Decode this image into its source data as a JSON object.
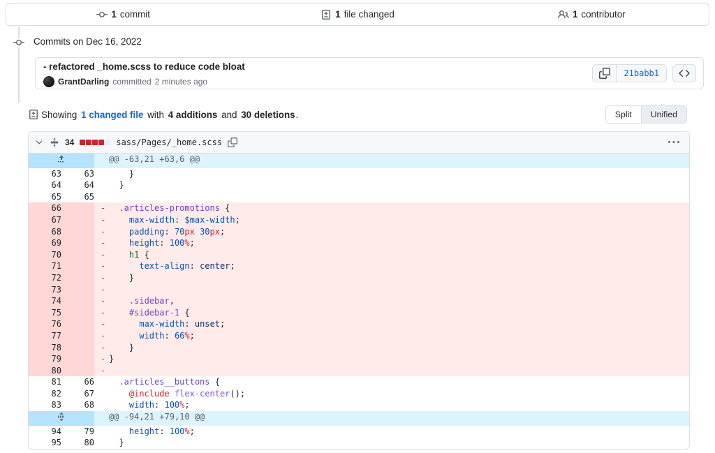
{
  "summary_tabs": [
    {
      "icon": "commit-icon",
      "count": "1",
      "label": "commit",
      "name": "tab-commits"
    },
    {
      "icon": "file-diff-icon",
      "count": "1",
      "label": "file changed",
      "name": "tab-files-changed"
    },
    {
      "icon": "people-icon",
      "count": "1",
      "label": "contributor",
      "name": "tab-contributors"
    }
  ],
  "timeline": {
    "heading": "Commits on Dec 16, 2022"
  },
  "commit": {
    "title": "- refactored _home.scss to reduce code bloat",
    "author": "GrantDarling",
    "meta_verb": "committed",
    "time": "2 minutes ago",
    "sha": "21babb1",
    "copy_icon": "copy-icon",
    "code_icon": "code-icon"
  },
  "showing": {
    "icon": "file-diff-icon",
    "prefix": "Showing",
    "file_link": "1 changed file",
    "with": "with",
    "additions": "4 additions",
    "and": "and",
    "deletions": "30 deletions",
    "period": ".",
    "view_modes": [
      {
        "label": "Split",
        "selected": false
      },
      {
        "label": "Unified",
        "selected": true
      }
    ]
  },
  "file": {
    "chevron_icon": "chevron-down-icon",
    "move_icon": "move-diff-icon",
    "change_count": "34",
    "stat_blocks": [
      "del",
      "del",
      "del",
      "del",
      "none"
    ],
    "path": "sass/Pages/_home.scss",
    "copy_path_icon": "copy-icon",
    "menu_icon": "kebab-horizontal-icon"
  },
  "diff_rows": [
    {
      "type": "hunk",
      "expand_icon": "expand-up-icon",
      "text": "@@ -63,21 +63,6 @@"
    },
    {
      "type": "ctx",
      "old": "63",
      "new": "63",
      "mark": " ",
      "parts": [
        {
          "t": "    }",
          "c": "s-pun"
        }
      ]
    },
    {
      "type": "ctx",
      "old": "64",
      "new": "64",
      "mark": " ",
      "parts": [
        {
          "t": "  }",
          "c": "s-pun"
        }
      ]
    },
    {
      "type": "ctx",
      "old": "65",
      "new": "65",
      "mark": " ",
      "parts": [
        {
          "t": "",
          "c": "s-pun"
        }
      ]
    },
    {
      "type": "del",
      "old": "66",
      "new": "",
      "mark": "-",
      "parts": [
        {
          "t": "  ",
          "c": "s-pun"
        },
        {
          "t": ".articles-promotions",
          "c": "s-sel"
        },
        {
          "t": " {",
          "c": "s-pun"
        }
      ]
    },
    {
      "type": "del",
      "old": "67",
      "new": "",
      "mark": "-",
      "parts": [
        {
          "t": "    ",
          "c": "s-pun"
        },
        {
          "t": "max-width",
          "c": "s-prop"
        },
        {
          "t": ": ",
          "c": "s-pun"
        },
        {
          "t": "$max-width",
          "c": "s-var"
        },
        {
          "t": ";",
          "c": "s-pun"
        }
      ]
    },
    {
      "type": "del",
      "old": "68",
      "new": "",
      "mark": "-",
      "parts": [
        {
          "t": "    ",
          "c": "s-pun"
        },
        {
          "t": "padding",
          "c": "s-prop"
        },
        {
          "t": ": ",
          "c": "s-pun"
        },
        {
          "t": "70",
          "c": "s-num"
        },
        {
          "t": "px",
          "c": "s-unit"
        },
        {
          "t": " ",
          "c": "s-pun"
        },
        {
          "t": "30",
          "c": "s-num"
        },
        {
          "t": "px",
          "c": "s-unit"
        },
        {
          "t": ";",
          "c": "s-pun"
        }
      ]
    },
    {
      "type": "del",
      "old": "69",
      "new": "",
      "mark": "-",
      "parts": [
        {
          "t": "    ",
          "c": "s-pun"
        },
        {
          "t": "height",
          "c": "s-prop"
        },
        {
          "t": ": ",
          "c": "s-pun"
        },
        {
          "t": "100",
          "c": "s-num"
        },
        {
          "t": "%",
          "c": "s-unit"
        },
        {
          "t": ";",
          "c": "s-pun"
        }
      ]
    },
    {
      "type": "del",
      "old": "70",
      "new": "",
      "mark": "-",
      "parts": [
        {
          "t": "    ",
          "c": "s-pun"
        },
        {
          "t": "h1",
          "c": "s-tag"
        },
        {
          "t": " {",
          "c": "s-pun"
        }
      ]
    },
    {
      "type": "del",
      "old": "71",
      "new": "",
      "mark": "-",
      "parts": [
        {
          "t": "      ",
          "c": "s-pun"
        },
        {
          "t": "text-align",
          "c": "s-prop"
        },
        {
          "t": ": ",
          "c": "s-pun"
        },
        {
          "t": "center",
          "c": "s-val"
        },
        {
          "t": ";",
          "c": "s-pun"
        }
      ]
    },
    {
      "type": "del",
      "old": "72",
      "new": "",
      "mark": "-",
      "parts": [
        {
          "t": "    }",
          "c": "s-pun"
        }
      ]
    },
    {
      "type": "del",
      "old": "73",
      "new": "",
      "mark": "-",
      "parts": [
        {
          "t": "",
          "c": "s-pun"
        }
      ]
    },
    {
      "type": "del",
      "old": "74",
      "new": "",
      "mark": "-",
      "parts": [
        {
          "t": "    ",
          "c": "s-pun"
        },
        {
          "t": ".sidebar",
          "c": "s-sel"
        },
        {
          "t": ",",
          "c": "s-pun"
        }
      ]
    },
    {
      "type": "del",
      "old": "75",
      "new": "",
      "mark": "-",
      "parts": [
        {
          "t": "    ",
          "c": "s-pun"
        },
        {
          "t": "#sidebar-1",
          "c": "s-sel"
        },
        {
          "t": " {",
          "c": "s-pun"
        }
      ]
    },
    {
      "type": "del",
      "old": "76",
      "new": "",
      "mark": "-",
      "parts": [
        {
          "t": "      ",
          "c": "s-pun"
        },
        {
          "t": "max-width",
          "c": "s-prop"
        },
        {
          "t": ": ",
          "c": "s-pun"
        },
        {
          "t": "unset",
          "c": "s-val"
        },
        {
          "t": ";",
          "c": "s-pun"
        }
      ]
    },
    {
      "type": "del",
      "old": "77",
      "new": "",
      "mark": "-",
      "parts": [
        {
          "t": "      ",
          "c": "s-pun"
        },
        {
          "t": "width",
          "c": "s-prop"
        },
        {
          "t": ": ",
          "c": "s-pun"
        },
        {
          "t": "66",
          "c": "s-num"
        },
        {
          "t": "%",
          "c": "s-unit"
        },
        {
          "t": ";",
          "c": "s-pun"
        }
      ]
    },
    {
      "type": "del",
      "old": "78",
      "new": "",
      "mark": "-",
      "parts": [
        {
          "t": "    }",
          "c": "s-pun"
        }
      ]
    },
    {
      "type": "del",
      "old": "79",
      "new": "",
      "mark": "-",
      "parts": [
        {
          "t": "}",
          "c": "s-pun"
        }
      ]
    },
    {
      "type": "del",
      "old": "80",
      "new": "",
      "mark": "-",
      "parts": [
        {
          "t": "",
          "c": "s-pun"
        }
      ]
    },
    {
      "type": "ctx",
      "old": "81",
      "new": "66",
      "mark": " ",
      "parts": [
        {
          "t": "  ",
          "c": "s-pun"
        },
        {
          "t": ".articles__buttons",
          "c": "s-sel"
        },
        {
          "t": " {",
          "c": "s-pun"
        }
      ]
    },
    {
      "type": "ctx",
      "old": "82",
      "new": "67",
      "mark": " ",
      "parts": [
        {
          "t": "    ",
          "c": "s-pun"
        },
        {
          "t": "@include",
          "c": "s-at"
        },
        {
          "t": " ",
          "c": "s-pun"
        },
        {
          "t": "flex-center",
          "c": "s-fn"
        },
        {
          "t": "();",
          "c": "s-pun"
        }
      ]
    },
    {
      "type": "ctx",
      "old": "83",
      "new": "68",
      "mark": " ",
      "parts": [
        {
          "t": "    ",
          "c": "s-pun"
        },
        {
          "t": "width",
          "c": "s-prop"
        },
        {
          "t": ": ",
          "c": "s-pun"
        },
        {
          "t": "100",
          "c": "s-num"
        },
        {
          "t": "%",
          "c": "s-unit"
        },
        {
          "t": ";",
          "c": "s-pun"
        }
      ]
    },
    {
      "type": "hunk",
      "expand_icon": "expand-up-down-icon",
      "text": "@@ -94,21 +79,10 @@"
    },
    {
      "type": "ctx",
      "old": "94",
      "new": "79",
      "mark": " ",
      "parts": [
        {
          "t": "    ",
          "c": "s-pun"
        },
        {
          "t": "height",
          "c": "s-prop"
        },
        {
          "t": ": ",
          "c": "s-pun"
        },
        {
          "t": "100",
          "c": "s-num"
        },
        {
          "t": "%",
          "c": "s-unit"
        },
        {
          "t": ";",
          "c": "s-pun"
        }
      ]
    },
    {
      "type": "ctx",
      "old": "95",
      "new": "80",
      "mark": " ",
      "parts": [
        {
          "t": "  }",
          "c": "s-pun"
        }
      ]
    }
  ],
  "colors": {
    "link": "#0969da",
    "deletion_bg": "#ffebe9",
    "deletion_gutter": "#ffd7d5",
    "hunk_bg": "#ddf4ff",
    "hunk_gutter": "#b6e3ff",
    "border": "#d8dee4",
    "danger": "#cf222e"
  }
}
